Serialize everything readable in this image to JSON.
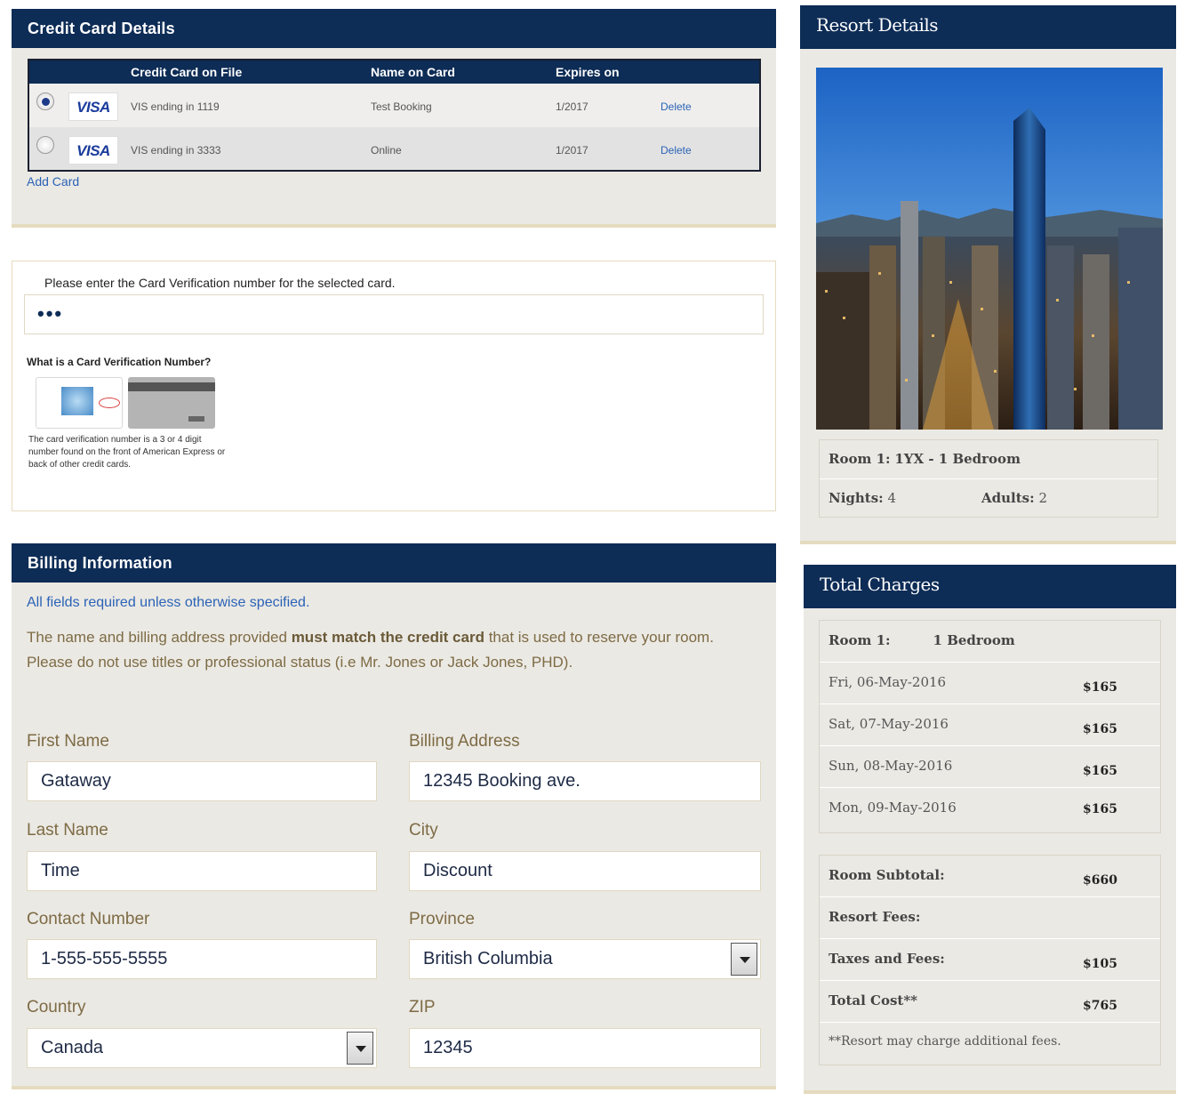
{
  "credit_card": {
    "title": "Credit Card Details",
    "columns": [
      "Credit Card on File",
      "Name on Card",
      "Expires on"
    ],
    "cards": [
      {
        "selected": true,
        "brand": "VISA",
        "number": "VIS ending in 1119",
        "name": "Test Booking",
        "expires": "1/2017",
        "action": "Delete"
      },
      {
        "selected": false,
        "brand": "VISA",
        "number": "VIS ending in 3333",
        "name": "Online",
        "expires": "1/2017",
        "action": "Delete"
      }
    ],
    "add_card": "Add Card"
  },
  "cvv": {
    "prompt": "Please enter the Card Verification number for the selected card.",
    "value": "•••",
    "help_title": "What is a Card Verification Number?",
    "help_text": "The card verification number is a 3 or 4 digit number found on the front of American Express or back of other credit cards."
  },
  "billing": {
    "title": "Billing Information",
    "required_note": "All fields required unless otherwise specified.",
    "notice_part1": "The name and billing address provided ",
    "notice_bold": "must match the credit card",
    "notice_part2": " that is used to reserve your room. Please do not use titles or professional status (i.e Mr. Jones or Jack Jones, PHD).",
    "first_name_label": "First Name",
    "first_name": "Gataway",
    "last_name_label": "Last Name",
    "last_name": "Time",
    "contact_label": "Contact Number",
    "contact": "1-555-555-5555",
    "country_label": "Country",
    "country": "Canada",
    "address_label": "Billing Address",
    "address": "12345 Booking ave.",
    "city_label": "City",
    "city": "Discount",
    "province_label": "Province",
    "province": "British Columbia",
    "zip_label": "ZIP",
    "zip": "12345"
  },
  "resort": {
    "title": "Resort Details",
    "room_label": "Room 1:",
    "room_value": "1YX - 1 Bedroom",
    "nights_label": "Nights:",
    "nights_value": "4",
    "adults_label": "Adults:",
    "adults_value": "2"
  },
  "charges": {
    "title": "Total Charges",
    "room_label": "Room 1:",
    "room_value": "1 Bedroom",
    "nights": [
      {
        "date": "Fri, 06-May-2016",
        "amount": "$165"
      },
      {
        "date": "Sat, 07-May-2016",
        "amount": "$165"
      },
      {
        "date": "Sun, 08-May-2016",
        "amount": "$165"
      },
      {
        "date": "Mon, 09-May-2016",
        "amount": "$165"
      }
    ],
    "subtotal_label": "Room Subtotal:",
    "subtotal": "$660",
    "resort_fees_label": "Resort Fees:",
    "resort_fees": "",
    "taxes_label": "Taxes and Fees:",
    "taxes": "$105",
    "total_label": "Total Cost**",
    "total": "$765",
    "footnote": "**Resort may charge additional fees."
  }
}
